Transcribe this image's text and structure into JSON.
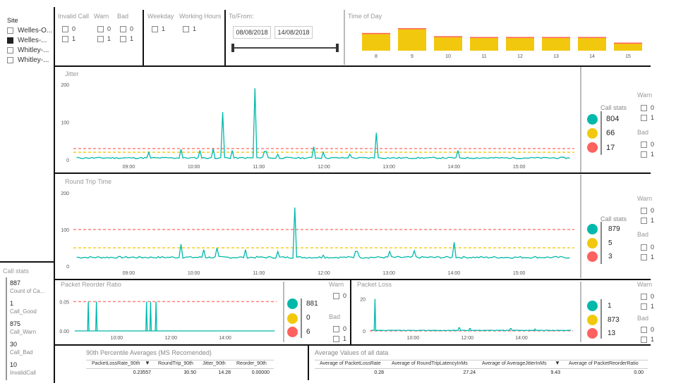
{
  "site": {
    "label": "Site",
    "items": [
      {
        "label": "Welles-O...",
        "checked": false
      },
      {
        "label": "Welles-...",
        "checked": true
      },
      {
        "label": "Whitley-...",
        "checked": false
      },
      {
        "label": "Whitley-...",
        "checked": false
      }
    ]
  },
  "filters": {
    "invalid_call": {
      "label": "Invalid Call",
      "options": [
        "0",
        "1"
      ]
    },
    "warn": {
      "label": "Warn",
      "options": [
        "0",
        "1"
      ]
    },
    "bad": {
      "label": "Bad",
      "options": [
        "0",
        "1"
      ]
    },
    "weekday": {
      "label": "Weekday",
      "options": [
        "1"
      ]
    },
    "working_hours": {
      "label": "Working Hours",
      "options": [
        "1"
      ]
    },
    "to_from": {
      "label": "To/From:",
      "start": "08/08/2018",
      "end": "14/08/2018"
    }
  },
  "time_of_day": {
    "title": "Time of Day",
    "chart_data": {
      "type": "bar",
      "categories": [
        "8",
        "9",
        "10",
        "11",
        "12",
        "13",
        "14",
        "15"
      ],
      "values": [
        22,
        28,
        18,
        17,
        17,
        17,
        17,
        10
      ],
      "colors": {
        "bar": "#F2C80F",
        "top": "#FD625E"
      }
    }
  },
  "jitter": {
    "title": "Jitter",
    "chart_data": {
      "type": "line",
      "ylim": [
        0,
        200
      ],
      "yticks": [
        "200",
        "100",
        "0"
      ],
      "xticks": [
        "09:00",
        "10:00",
        "11:00",
        "12:00",
        "13:00",
        "14:00",
        "15:00"
      ],
      "bad_threshold": 30,
      "warn_threshold": 20,
      "spikes": [
        [
          10.45,
          127
        ],
        [
          10.95,
          190
        ],
        [
          10.6,
          25
        ],
        [
          11.1,
          22
        ],
        [
          11.3,
          15
        ],
        [
          11.85,
          35
        ],
        [
          12.0,
          20
        ],
        [
          12.8,
          72
        ],
        [
          12.4,
          15
        ],
        [
          14.05,
          25
        ],
        [
          9.3,
          20
        ],
        [
          9.8,
          28
        ],
        [
          10.1,
          25
        ],
        [
          10.3,
          30
        ]
      ]
    },
    "stats_label": "Call stats",
    "stats": [
      "804",
      "66",
      "17"
    ],
    "warn_label": "Warn",
    "bad_label": "Bad",
    "options": [
      "0",
      "1"
    ]
  },
  "rtt": {
    "title": "Round Trip Time",
    "chart_data": {
      "type": "line",
      "ylim": [
        0,
        200
      ],
      "yticks": [
        "200",
        "100",
        "0"
      ],
      "xticks": [
        "09:00",
        "10:00",
        "11:00",
        "12:00",
        "13:00",
        "14:00",
        "15:00"
      ],
      "bad_threshold": 100,
      "warn_threshold": 50,
      "spikes": [
        [
          11.55,
          160
        ],
        [
          9.8,
          60
        ],
        [
          10.35,
          50
        ],
        [
          10.15,
          45
        ],
        [
          10.8,
          45
        ],
        [
          11.3,
          40
        ],
        [
          12.5,
          40
        ],
        [
          13.0,
          40
        ],
        [
          13.4,
          42
        ],
        [
          14.0,
          65
        ],
        [
          12.0,
          30
        ]
      ]
    },
    "stats_label": "Call stats",
    "stats": [
      "879",
      "5",
      "3"
    ],
    "warn_label": "Warn",
    "bad_label": "Bad",
    "options": [
      "0",
      "1"
    ]
  },
  "reorder": {
    "title": "Packet Reorder Ratio",
    "chart_data": {
      "type": "line",
      "ylim": [
        0,
        0.06
      ],
      "yticks": [
        "0.05",
        "0.00"
      ],
      "xticks": [
        "10:00",
        "12:00",
        "14:00"
      ],
      "bad_threshold": 0.05
    },
    "stats": [
      "881",
      "0",
      "6"
    ],
    "warn_label": "Warn",
    "bad_label": "Bad",
    "options": [
      "0",
      "1"
    ]
  },
  "loss": {
    "title": "Packet Loss",
    "chart_data": {
      "type": "line",
      "ylim": [
        0,
        22
      ],
      "yticks": [
        "20",
        "0"
      ],
      "xticks": [
        "10:00",
        "12:00",
        "14:00"
      ],
      "bad_threshold": 0
    },
    "stats": [
      "1",
      "873",
      "13"
    ],
    "warn_label": "Warn",
    "bad_label": "Bad",
    "options": [
      "0",
      "1"
    ]
  },
  "call_stats": {
    "title": "Call stats",
    "items": [
      {
        "value": "887",
        "label": "Count of Ca..."
      },
      {
        "value": "1",
        "label": "Call_Good"
      },
      {
        "value": "875",
        "label": "Call_Warn"
      },
      {
        "value": "30",
        "label": "Call_Bad"
      },
      {
        "value": "10",
        "label": "InvalidCall"
      }
    ]
  },
  "percentile": {
    "title": "90th Percentile Averages (MS Recomended)",
    "headers": [
      "PacketLossRate_90th",
      "RoundTrip_90th",
      "Jitter_90th",
      "Reorder_90th"
    ],
    "values": [
      "0.23557",
      "30.50",
      "14.28",
      "0.00000"
    ]
  },
  "averages": {
    "title": "Average Values of all data",
    "headers": [
      "Average of PacketLossRate",
      "Average of RoundTripLatencyInMs",
      "Average of AverageJitterInMs",
      "Average of PacketReorderRatio"
    ],
    "values": [
      "0.28",
      "27.24",
      "9.43",
      "0.00"
    ]
  },
  "colors": {
    "good": "#01B8AA",
    "warn": "#F2C80F",
    "bad": "#FD625E",
    "line": "#01B8AA"
  }
}
